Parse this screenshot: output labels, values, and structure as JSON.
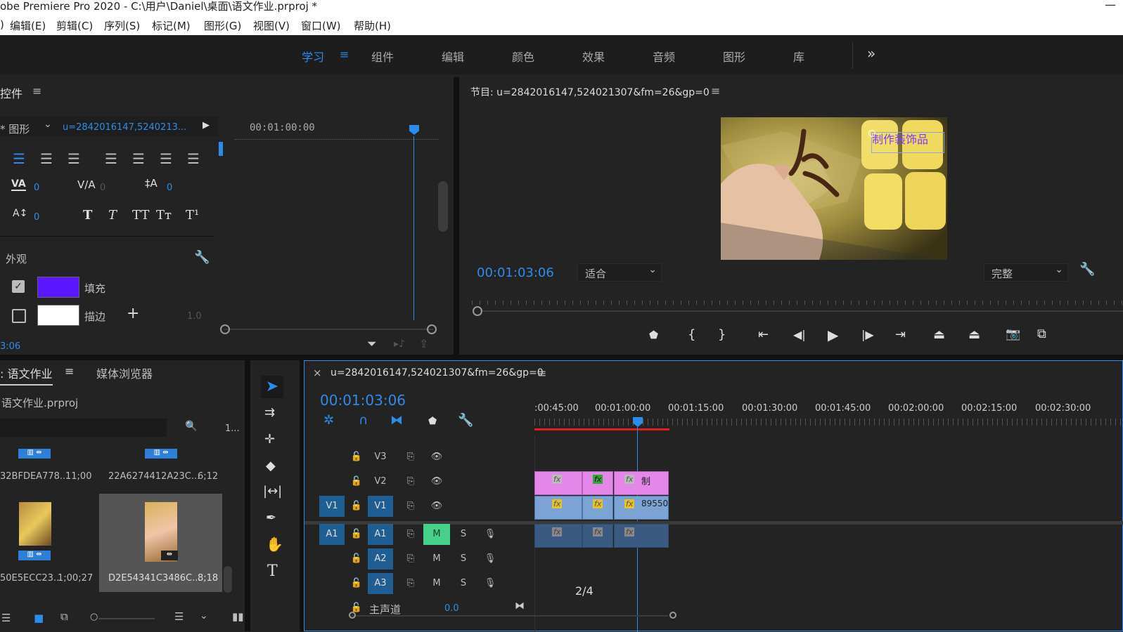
{
  "window": {
    "title": "obe Premiere Pro 2020 - C:\\用户\\Daniel\\桌面\\语文作业.prproj *"
  },
  "menu": [
    "编辑(E)",
    "剪辑(C)",
    "序列(S)",
    "标记(M)",
    "图形(G)",
    "视图(V)",
    "窗口(W)",
    "帮助(H)"
  ],
  "workspace": {
    "tabs": [
      "学习",
      "组件",
      "编辑",
      "颜色",
      "效果",
      "音频",
      "图形",
      "库"
    ],
    "active": "学习",
    "more": "»"
  },
  "controls": {
    "title": "控件",
    "graphics_label": "图形",
    "clip_name": "u=2842016147,5240213...",
    "timecode": "00:01:00:00",
    "tracking_value": "0",
    "kerning_value": "0",
    "leading_value": "0",
    "baseline_value": "0",
    "appearance_label": "外观",
    "fill_label": "填充",
    "fill_color": "#5a17ff",
    "stroke_label": "描边",
    "stroke_color": "#ffffff",
    "stroke_width": "1.0",
    "bottom_time": "3:06"
  },
  "program": {
    "title": "节目: u=2842016147,524021307&fm=26&gp=0",
    "overlay_text": "制作装饰品",
    "timecode": "00:01:03:06",
    "fit_option": "适合",
    "quality_option": "完整"
  },
  "project": {
    "tab_project": "语文作业",
    "tab_media": "媒体浏览器",
    "file_name": "语文作业.prproj",
    "item_count": "1...",
    "items": [
      {
        "name": "32BFDEA778...",
        "duration": "11;00"
      },
      {
        "name": "22A6274412A23C...",
        "duration": "6;12"
      },
      {
        "name": "50E5ECC23...",
        "duration": "1;00;27"
      },
      {
        "name": "D2E54341C3486C...",
        "duration": "8;18"
      }
    ]
  },
  "timeline": {
    "sequence_name": "u=2842016147,524021307&fm=26&gp=0",
    "timecode": "00:01:03:06",
    "ruler_labels": [
      ":00:45:00",
      "00:01:00:00",
      "00:01:15:00",
      "00:01:30:00",
      "00:01:45:00",
      "00:02:00:00",
      "00:02:15:00",
      "00:02:30:00"
    ],
    "tracks": {
      "v3": "V3",
      "v2": "V2",
      "v1": "V1",
      "v1_source": "V1",
      "a1": "A1",
      "a1_source": "A1",
      "a2": "A2",
      "a3": "A3"
    },
    "mute_label": "M",
    "solo_label": "S",
    "master_label": "主声道",
    "master_value": "0.0",
    "clip_v2_text": "制",
    "clip_v1_number": "89550",
    "fx_label": "fx",
    "page_indicator": "2/4"
  }
}
